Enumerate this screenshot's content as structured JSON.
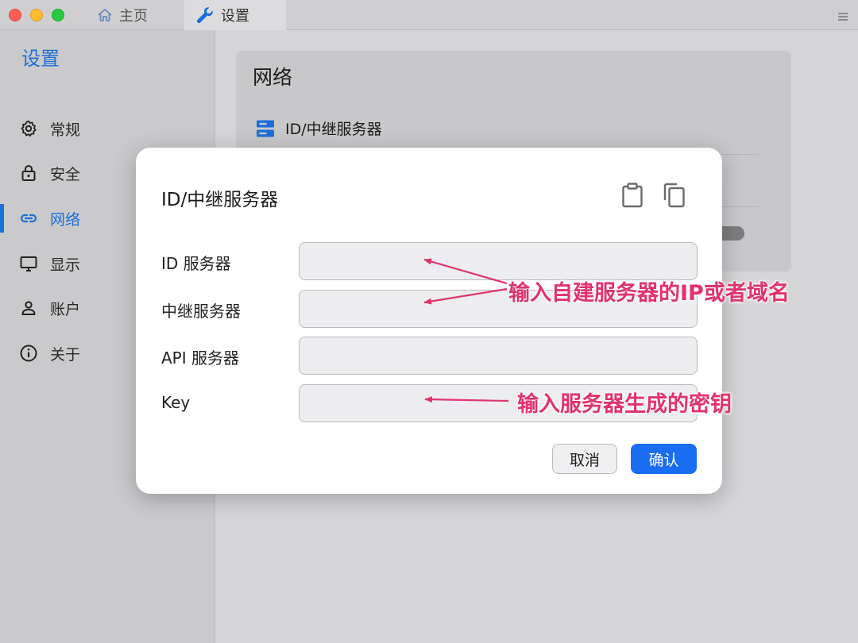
{
  "window": {
    "tabs": [
      {
        "label": "主页",
        "icon": "home-icon"
      },
      {
        "label": "设置",
        "icon": "wrench-icon"
      }
    ],
    "menu_icon": "hamburger-menu-icon"
  },
  "sidebar": {
    "title": "设置",
    "items": [
      {
        "label": "常规",
        "icon": "gear-icon"
      },
      {
        "label": "安全",
        "icon": "lock-icon"
      },
      {
        "label": "网络",
        "icon": "link-icon",
        "active": true
      },
      {
        "label": "显示",
        "icon": "monitor-icon"
      },
      {
        "label": "账户",
        "icon": "user-icon"
      },
      {
        "label": "关于",
        "icon": "info-icon"
      }
    ]
  },
  "panel": {
    "title": "网络",
    "row_label": "ID/中继服务器"
  },
  "dialog": {
    "title": "ID/中继服务器",
    "fields": [
      {
        "label": "ID 服务器",
        "value": ""
      },
      {
        "label": "中继服务器",
        "value": ""
      },
      {
        "label": "API 服务器",
        "value": ""
      },
      {
        "label": "Key",
        "value": ""
      }
    ],
    "cancel_label": "取消",
    "ok_label": "确认"
  },
  "annotations": {
    "server_hint": "输入自建服务器的IP或者域名",
    "key_hint": "输入服务器生成的密钥"
  },
  "colors": {
    "accent": "#1a6fd9",
    "primary_button": "#1a6cf0",
    "annotation": "#e0336d"
  }
}
